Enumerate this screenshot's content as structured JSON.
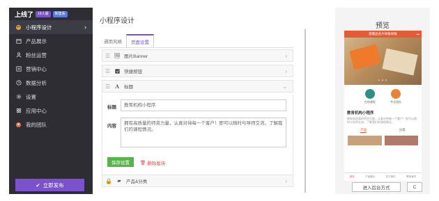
{
  "sidebar": {
    "brand": "上线了",
    "badge1": "19人版",
    "badge2": "新建系",
    "items": [
      {
        "label": "小程序设计",
        "icon": "palette-icon"
      },
      {
        "label": "产品展示",
        "icon": "box-icon"
      },
      {
        "label": "粉丝运营",
        "icon": "users-icon"
      },
      {
        "label": "营销中心",
        "icon": "megaphone-icon"
      },
      {
        "label": "数据分析",
        "icon": "clock-icon"
      },
      {
        "label": "设置",
        "icon": "gear-icon"
      },
      {
        "label": "应用中心",
        "icon": "apps-icon"
      },
      {
        "label": "我的团队",
        "icon": "team-icon"
      }
    ],
    "publish_label": "立即发布"
  },
  "main": {
    "page_title": "小程序设计",
    "tabs": [
      {
        "label": "通用风格"
      },
      {
        "label": "页面设置"
      }
    ],
    "rows": {
      "banner": "图片Banner",
      "quick_buttons": "快捷按钮",
      "title": "标题",
      "products": "产品&分类"
    },
    "form": {
      "title_label": "标题",
      "title_value": "教育机构小程序",
      "content_label": "内容",
      "content_value": "拥有高质量的师资力量，认真对待每一个客户！即可以随时与导师交流，了解我们的课程情况。",
      "save_label": "保存设置",
      "delete_label": "删除版块"
    }
  },
  "preview": {
    "title": "预览",
    "app_header": "部署品名片样板样版",
    "icon1_label": "在线课程",
    "icon2_label": "专业团队",
    "section_title": "教育机构小程序",
    "section_desc": "拥有高质量的师资力量，认真对待每一个客户！即可以随时与导师交流，了解我们的课程情况。",
    "tab1": "产品",
    "tab2": "分类",
    "nav": [
      "首页",
      "产品展示",
      "关于我们",
      "联系我们"
    ],
    "enter_label": "进入后台方式",
    "side_label": "C"
  },
  "colors": {
    "accent": "#7b52cc",
    "sidebar_bg": "#2d2d33",
    "save_green": "#56b44a",
    "delete_red": "#e04848",
    "preview_red": "#e55b39"
  }
}
